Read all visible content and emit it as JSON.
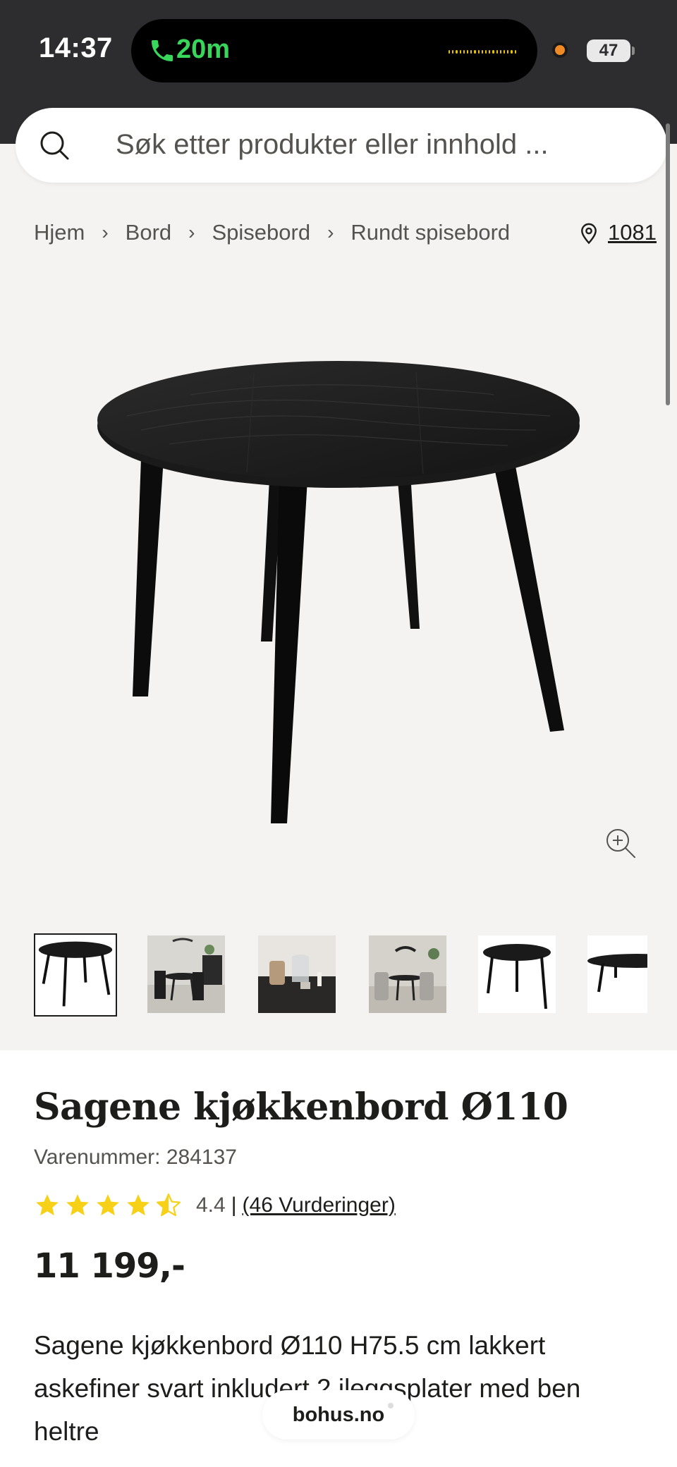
{
  "status_bar": {
    "time": "14:37",
    "call_duration": "20m",
    "battery": "47"
  },
  "search": {
    "placeholder": "Søk etter produkter eller innhold ..."
  },
  "breadcrumb": {
    "items": [
      "Hjem",
      "Bord",
      "Spisebord",
      "Rundt spisebord"
    ],
    "location_code": "1081"
  },
  "product": {
    "title": "Sagene kjøkkenbord Ø110",
    "sku_label": "Varenummer: 284137",
    "rating_value": "4.4",
    "rating_separator": "|",
    "rating_count": "(46 Vurderinger)",
    "stars_filled": 4.5,
    "price": "11 199,-",
    "description": "Sagene kjøkkenbord Ø110 H75.5 cm lakkert askefiner svart inkludert 2 ileggsplater med ben heltre",
    "thumbnail_count": 6
  },
  "site_badge": "bohus.no",
  "colors": {
    "accent_star": "#f7d117",
    "status_bar_bg": "#2d2d2f",
    "call_green": "#38d65a",
    "page_bg": "#f4f3f1"
  }
}
